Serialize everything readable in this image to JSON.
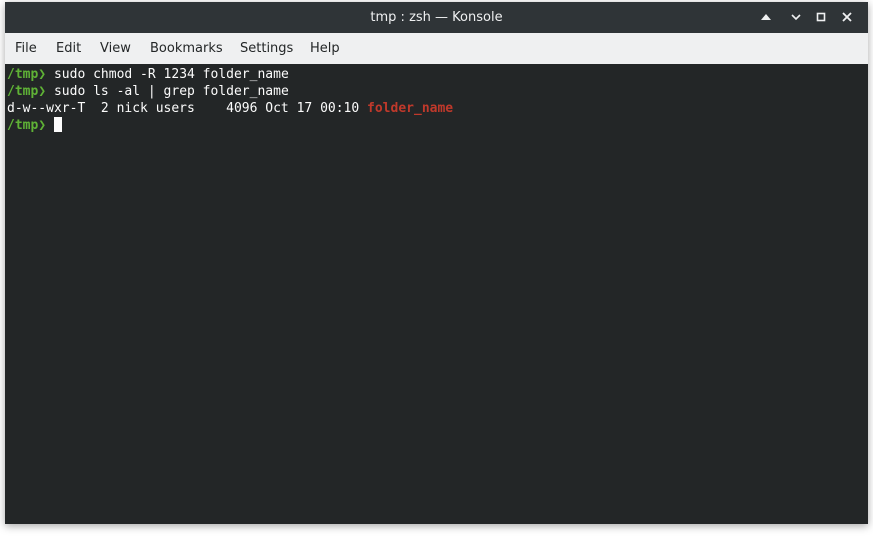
{
  "window": {
    "title": "tmp : zsh — Konsole"
  },
  "titlebar_buttons": {
    "keep_above_icon": "chevron-up-icon",
    "minimize_icon": "minimize-icon",
    "maximize_icon": "maximize-icon",
    "close_icon": "close-icon"
  },
  "menu": {
    "file": "File",
    "edit": "Edit",
    "view": "View",
    "bookmarks": "Bookmarks",
    "settings": "Settings",
    "help": "Help"
  },
  "terminal": {
    "lines": [
      {
        "prompt": "/tmp❯",
        "command": " sudo chmod -R 1234 folder_name"
      },
      {
        "prompt": "/tmp❯",
        "command": " sudo ls -al | grep folder_name"
      },
      {
        "output": "d-w--wxr-T  2 nick users    4096 Oct 17 00:10 ",
        "highlight": "folder_name"
      },
      {
        "prompt": "/tmp❯",
        "command": " "
      }
    ]
  },
  "colors": {
    "terminal_bg": "#232627",
    "titlebar_bg": "#2f3437",
    "menubar_bg": "#eff0f1",
    "prompt": "#5fb236",
    "directory": "#c0392b",
    "text": "#fcfcfc"
  }
}
